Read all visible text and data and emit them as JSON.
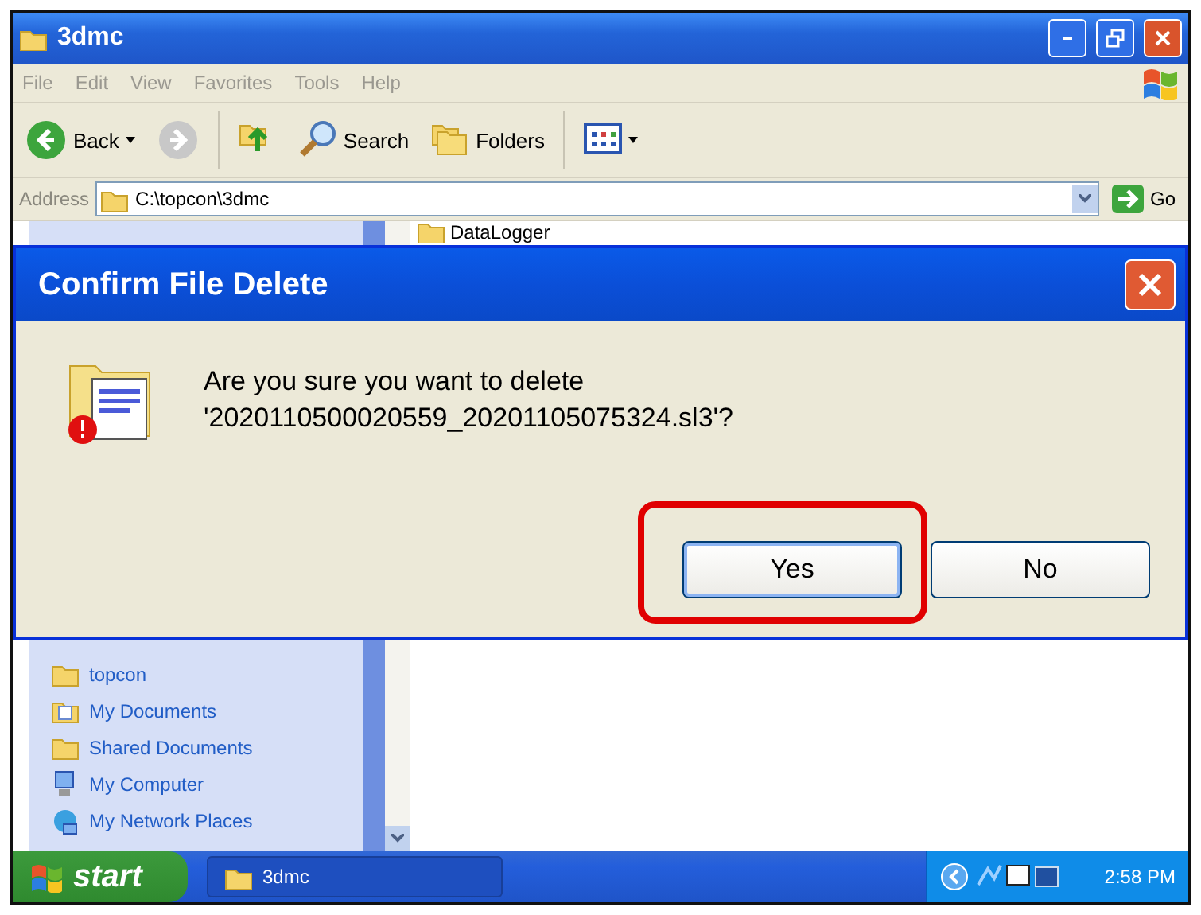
{
  "window": {
    "title": "3dmc"
  },
  "menu": [
    "File",
    "Edit",
    "View",
    "Favorites",
    "Tools",
    "Help"
  ],
  "toolbar": [
    {
      "kind": "back",
      "label": "Back"
    },
    {
      "kind": "forward"
    },
    {
      "kind": "up"
    },
    {
      "kind": "search",
      "label": "Search"
    },
    {
      "kind": "folders",
      "label": "Folders"
    },
    {
      "kind": "views"
    }
  ],
  "address": {
    "label": "Address",
    "value": "C:\\topcon\\3dmc",
    "go": "Go"
  },
  "file_list": {
    "items": [
      "DataLogger"
    ]
  },
  "sidebar": {
    "items": [
      {
        "kind": "folder",
        "label": "topcon"
      },
      {
        "kind": "documents",
        "label": "My Documents"
      },
      {
        "kind": "folder",
        "label": "Shared Documents"
      },
      {
        "kind": "computer",
        "label": "My Computer"
      },
      {
        "kind": "network",
        "label": "My Network Places"
      }
    ]
  },
  "dialog": {
    "title": "Confirm File Delete",
    "message": "Are you sure you want to delete",
    "file": "'2020110500020559_20201105075324.sl3'?",
    "buttons": [
      {
        "label": "Yes",
        "focused": true,
        "highlighted": true
      },
      {
        "label": "No",
        "focused": false,
        "highlighted": false
      }
    ]
  },
  "taskbar": {
    "start": "start",
    "tasks": [
      {
        "label": "3dmc",
        "selected": false
      }
    ],
    "clock": "2:58 PM"
  }
}
